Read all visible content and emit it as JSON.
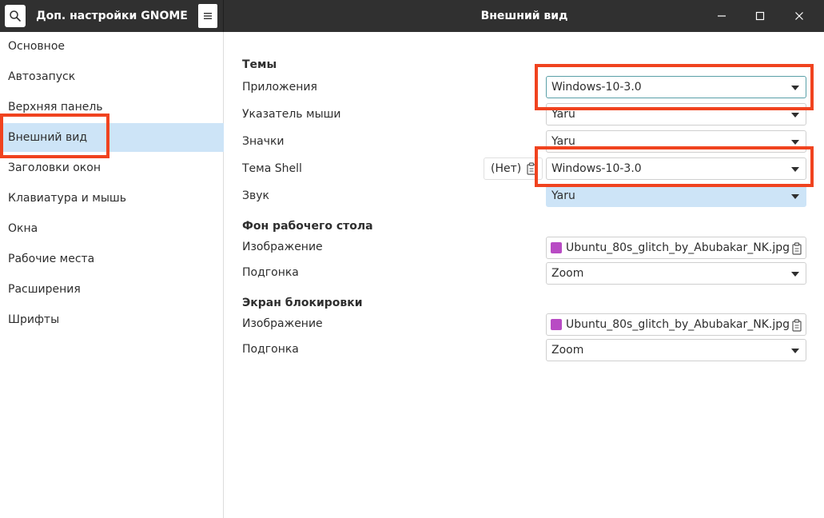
{
  "header": {
    "app_title": "Доп. настройки GNOME",
    "page_title": "Внешний вид",
    "search_icon": "search-icon",
    "menu_icon": "hamburger-icon"
  },
  "sidebar": {
    "items": [
      {
        "label": "Основное"
      },
      {
        "label": "Автозапуск"
      },
      {
        "label": "Верхняя панель"
      },
      {
        "label": "Внешний вид",
        "selected": true
      },
      {
        "label": "Заголовки окон"
      },
      {
        "label": "Клавиатура и мышь"
      },
      {
        "label": "Окна"
      },
      {
        "label": "Рабочие места"
      },
      {
        "label": "Расширения"
      },
      {
        "label": "Шрифты"
      }
    ]
  },
  "themes": {
    "title": "Темы",
    "applications": {
      "label": "Приложения",
      "value": "Windows-10-3.0"
    },
    "cursor": {
      "label": "Указатель мыши",
      "value": "Yaru"
    },
    "icons": {
      "label": "Значки",
      "value": "Yaru"
    },
    "shell": {
      "label": "Тема Shell",
      "value": "Windows-10-3.0",
      "none_label": "(Нет)"
    },
    "sound": {
      "label": "Звук",
      "value": "Yaru"
    }
  },
  "desktop_background": {
    "title": "Фон рабочего стола",
    "image": {
      "label": "Изображение",
      "value": "Ubuntu_80s_glitch_by_Abubakar_NK.jpg"
    },
    "adjustment": {
      "label": "Подгонка",
      "value": "Zoom"
    }
  },
  "lock_screen": {
    "title": "Экран блокировки",
    "image": {
      "label": "Изображение",
      "value": "Ubuntu_80s_glitch_by_Abubakar_NK.jpg"
    },
    "adjustment": {
      "label": "Подгонка",
      "value": "Zoom"
    }
  },
  "colors": {
    "headerbar": "#303030",
    "selection": "#cde4f7",
    "annotation": "#f0431f",
    "image_icon": "#b84bc4"
  }
}
